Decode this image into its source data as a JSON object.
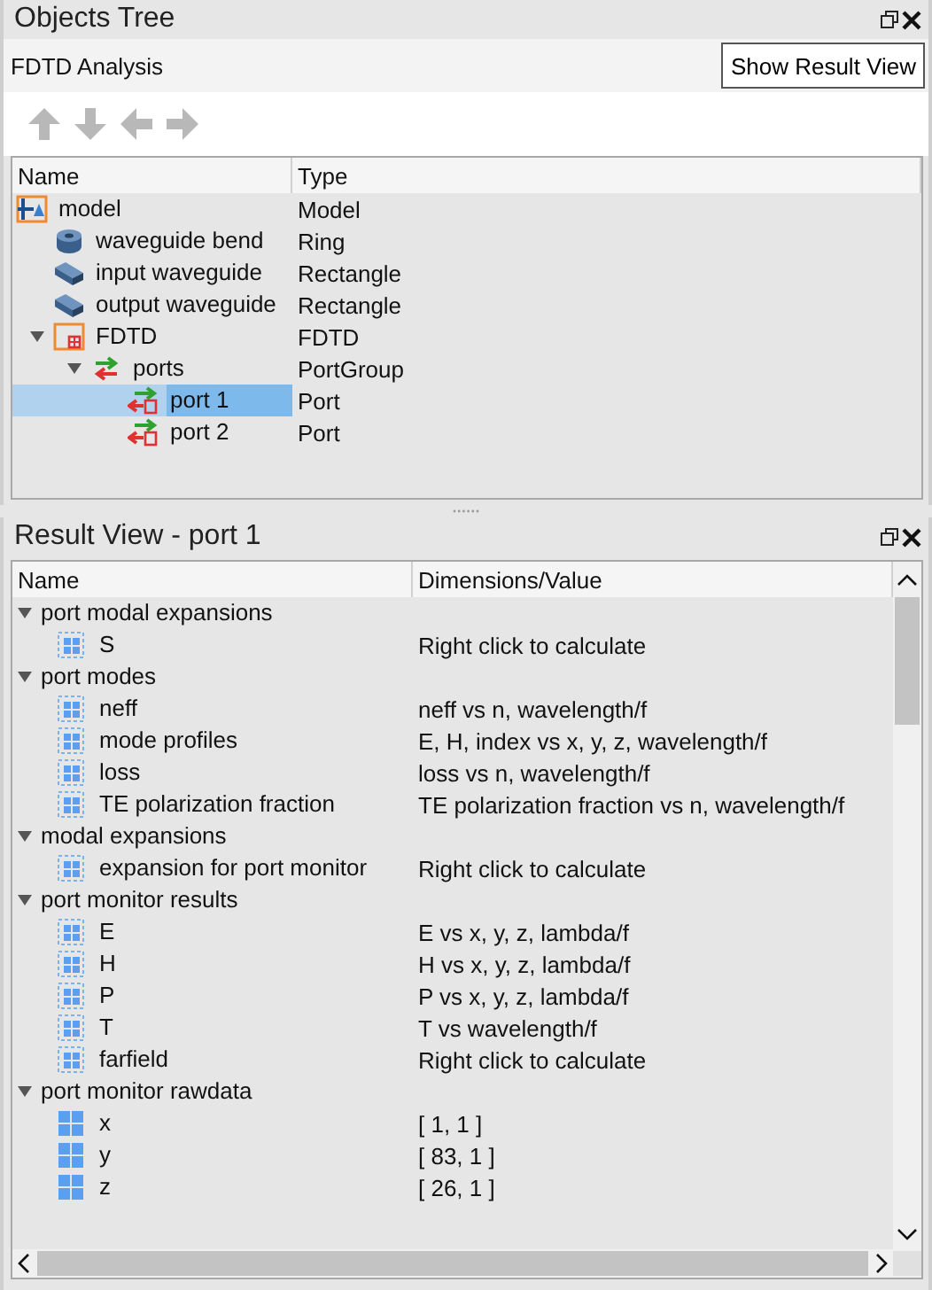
{
  "objects_panel": {
    "title": "Objects Tree",
    "analysis_label": "FDTD Analysis",
    "show_button": "Show Result View",
    "columns": [
      "Name",
      "Type"
    ],
    "tree": [
      {
        "name": "model",
        "type": "Model",
        "kind": "model",
        "selected": false,
        "children": [
          {
            "name": "waveguide bend",
            "type": "Ring",
            "kind": "ring",
            "selected": false
          },
          {
            "name": "input waveguide",
            "type": "Rectangle",
            "kind": "rect",
            "selected": false
          },
          {
            "name": "output waveguide",
            "type": "Rectangle",
            "kind": "rect",
            "selected": false
          },
          {
            "name": "FDTD",
            "type": "FDTD",
            "kind": "fdtd",
            "selected": false,
            "expanded": true,
            "children": [
              {
                "name": "ports",
                "type": "PortGroup",
                "kind": "portgroup",
                "selected": false,
                "expanded": true,
                "children": [
                  {
                    "name": "port 1",
                    "type": "Port",
                    "kind": "port",
                    "selected": true
                  },
                  {
                    "name": "port 2",
                    "type": "Port",
                    "kind": "port",
                    "selected": false
                  }
                ]
              }
            ]
          }
        ]
      }
    ]
  },
  "result_panel": {
    "title": "Result View - port 1",
    "columns": [
      "Name",
      "Dimensions/Value"
    ],
    "groups": [
      {
        "name": "port modal expansions",
        "expanded": true,
        "items": [
          {
            "name": "S",
            "value": "Right click to calculate",
            "kind": "pending"
          }
        ]
      },
      {
        "name": "port modes",
        "expanded": true,
        "items": [
          {
            "name": "neff",
            "value": "neff vs n, wavelength/f",
            "kind": "pending"
          },
          {
            "name": "mode profiles",
            "value": "E, H, index vs x, y, z, wavelength/f",
            "kind": "pending"
          },
          {
            "name": "loss",
            "value": "loss vs n, wavelength/f",
            "kind": "pending"
          },
          {
            "name": "TE polarization fraction",
            "value": "TE polarization fraction vs n, wavelength/f",
            "kind": "pending"
          }
        ]
      },
      {
        "name": "modal expansions",
        "expanded": true,
        "items": [
          {
            "name": "expansion for port monitor",
            "value": "Right click to calculate",
            "kind": "pending"
          }
        ]
      },
      {
        "name": "port monitor results",
        "expanded": true,
        "items": [
          {
            "name": "E",
            "value": "E vs x, y, z, lambda/f",
            "kind": "pending"
          },
          {
            "name": "H",
            "value": "H vs x, y, z, lambda/f",
            "kind": "pending"
          },
          {
            "name": "P",
            "value": "P vs x, y, z, lambda/f",
            "kind": "pending"
          },
          {
            "name": "T",
            "value": "T vs wavelength/f",
            "kind": "pending"
          },
          {
            "name": "farfield",
            "value": "Right click to calculate",
            "kind": "pending"
          }
        ]
      },
      {
        "name": "port monitor rawdata",
        "expanded": true,
        "items": [
          {
            "name": "x",
            "value": "[ 1, 1 ]",
            "kind": "raw"
          },
          {
            "name": "y",
            "value": "[ 83, 1 ]",
            "kind": "raw"
          },
          {
            "name": "z",
            "value": "[ 26, 1 ]",
            "kind": "raw"
          }
        ]
      }
    ]
  }
}
